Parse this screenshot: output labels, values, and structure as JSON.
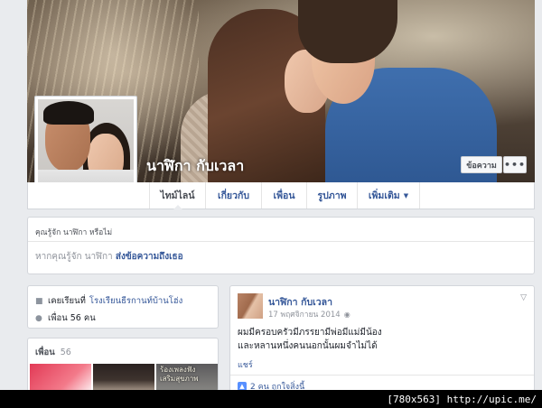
{
  "profile": {
    "name": "นาฬิกา กับเวลา"
  },
  "cover_actions": {
    "message_label": "ข้อความ",
    "more_label": "•••"
  },
  "nav": {
    "tabs": [
      {
        "label": "ไทม์ไลน์"
      },
      {
        "label": "เกี่ยวกับ"
      },
      {
        "label": "เพื่อน"
      },
      {
        "label": "รูปภาพ"
      },
      {
        "label": "เพิ่มเติม"
      }
    ],
    "active_index": 0
  },
  "know_box": {
    "title": "คุณรู้จัก นาฬิกา หรือไม่",
    "prefix": "หากคุณรู้จัก นาฬิกา",
    "link": "ส่งข้อความถึงเธอ"
  },
  "intro": {
    "studied_label": "เคยเรียนที่",
    "school": "โรงเรียนธีรกานท์บ้านโฮ่ง",
    "friends_label": "เพื่อน 56 คน"
  },
  "friends_box": {
    "title": "เพื่อน",
    "count": "56",
    "thumb_caption_line1": "ร้องเพลงฟัง",
    "thumb_caption_line2": "เสริมสุขภาพ"
  },
  "post": {
    "author": "นาฬิกา กับเวลา",
    "date": "17 พฤศจิกายน 2014",
    "audience_icon": "globe-icon",
    "text_line1": "ผมมีครอบครัวมีภรรยามีพ่อมีแม่มีน้อง",
    "text_line2": "และหลานหนึ่งคนนอกนั้นผมจำไม่ได้",
    "share": "แชร์",
    "likes": "2 คน ถูกใจสิ่งนี้"
  },
  "watermark": "[780x563] http://upic.me/",
  "colors": {
    "link": "#365899",
    "background": "#e9ebee",
    "muted": "#90949c"
  }
}
